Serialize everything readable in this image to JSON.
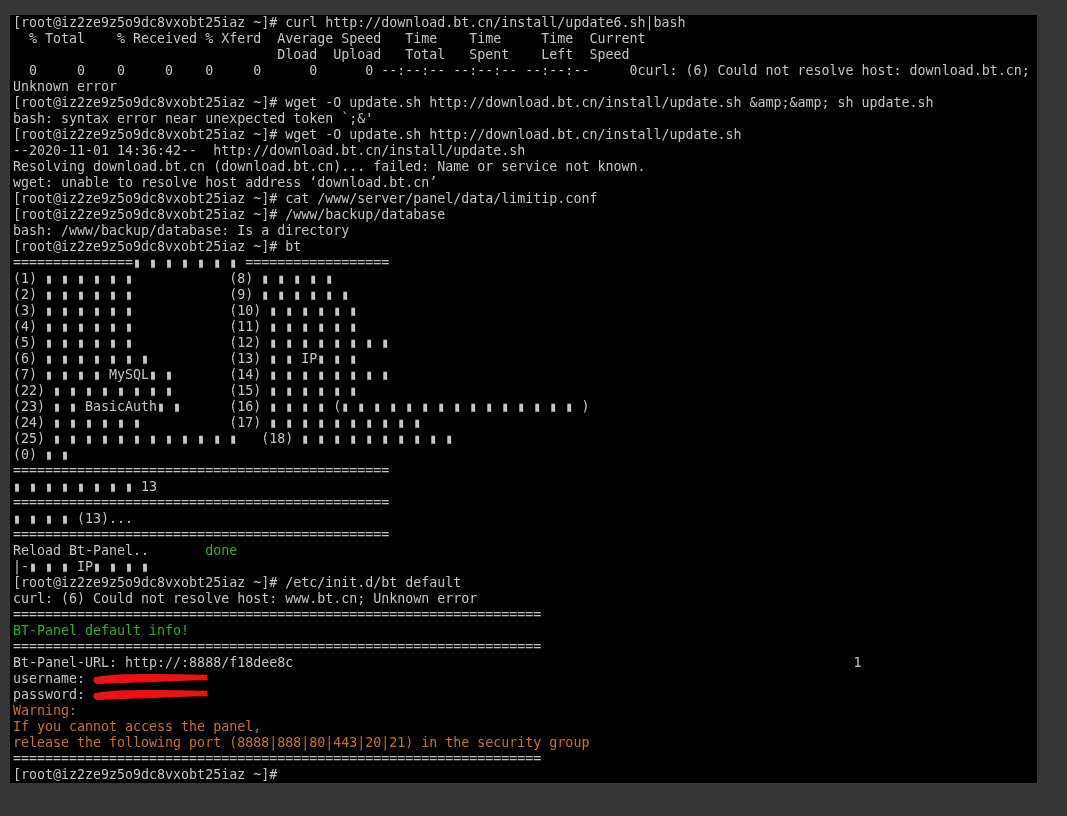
{
  "terminal": {
    "lines": [
      {
        "segments": [
          {
            "text": "[root@iz2ze9z5o9dc8vxobt25iaz ~]# curl http://download.bt.cn/install/update6.sh|bash",
            "color": "#c4c4c4"
          }
        ]
      },
      {
        "segments": [
          {
            "text": "  % Total    % Received % Xferd  Average Speed   Time    Time     Time  Current",
            "color": "#c4c4c4"
          }
        ]
      },
      {
        "segments": [
          {
            "text": "                                 Dload  Upload   Total   Spent    Left  Speed",
            "color": "#c4c4c4"
          }
        ]
      },
      {
        "segments": [
          {
            "text": "  0     0    0     0    0     0      0      0 --:--:-- --:--:-- --:--:--     0curl: (6) Could not resolve host: download.bt.cn;",
            "color": "#c4c4c4"
          }
        ]
      },
      {
        "segments": [
          {
            "text": "Unknown error",
            "color": "#c4c4c4"
          }
        ]
      },
      {
        "segments": [
          {
            "text": "[root@iz2ze9z5o9dc8vxobt25iaz ~]# wget -O update.sh http://download.bt.cn/install/update.sh &amp;&amp; sh update.sh",
            "color": "#c4c4c4"
          }
        ]
      },
      {
        "segments": [
          {
            "text": "bash: syntax error near unexpected token `;&'",
            "color": "#c4c4c4"
          }
        ]
      },
      {
        "segments": [
          {
            "text": "[root@iz2ze9z5o9dc8vxobt25iaz ~]# wget -O update.sh http://download.bt.cn/install/update.sh",
            "color": "#c4c4c4"
          }
        ]
      },
      {
        "segments": [
          {
            "text": "--2020-11-01 14:36:42--  http://download.bt.cn/install/update.sh",
            "color": "#c4c4c4"
          }
        ]
      },
      {
        "segments": [
          {
            "text": "Resolving download.bt.cn (download.bt.cn)... failed: Name or service not known.",
            "color": "#c4c4c4"
          }
        ]
      },
      {
        "segments": [
          {
            "text": "wget: unable to resolve host address ‘download.bt.cn’",
            "color": "#c4c4c4"
          }
        ]
      },
      {
        "segments": [
          {
            "text": "[root@iz2ze9z5o9dc8vxobt25iaz ~]# cat /www/server/panel/data/limitip.conf",
            "color": "#c4c4c4"
          }
        ]
      },
      {
        "segments": [
          {
            "text": "[root@iz2ze9z5o9dc8vxobt25iaz ~]# /www/backup/database",
            "color": "#c4c4c4"
          }
        ]
      },
      {
        "segments": [
          {
            "text": "bash: /www/backup/database: Is a directory",
            "color": "#c4c4c4"
          }
        ]
      },
      {
        "segments": [
          {
            "text": "[root@iz2ze9z5o9dc8vxobt25iaz ~]# bt",
            "color": "#c4c4c4"
          }
        ]
      },
      {
        "segments": [
          {
            "text": "===============▮ ▮ ▮ ▮ ▮ ▮ ▮ ==================",
            "color": "#c4c4c4"
          }
        ]
      },
      {
        "segments": [
          {
            "text": "(1) ▮ ▮ ▮ ▮ ▮ ▮            (8) ▮ ▮ ▮ ▮ ▮",
            "color": "#c4c4c4"
          }
        ]
      },
      {
        "segments": [
          {
            "text": "(2) ▮ ▮ ▮ ▮ ▮ ▮            (9) ▮ ▮ ▮ ▮ ▮ ▮",
            "color": "#c4c4c4"
          }
        ]
      },
      {
        "segments": [
          {
            "text": "(3) ▮ ▮ ▮ ▮ ▮ ▮            (10) ▮ ▮ ▮ ▮ ▮ ▮",
            "color": "#c4c4c4"
          }
        ]
      },
      {
        "segments": [
          {
            "text": "(4) ▮ ▮ ▮ ▮ ▮ ▮            (11) ▮ ▮ ▮ ▮ ▮ ▮",
            "color": "#c4c4c4"
          }
        ]
      },
      {
        "segments": [
          {
            "text": "(5) ▮ ▮ ▮ ▮ ▮ ▮            (12) ▮ ▮ ▮ ▮ ▮ ▮ ▮ ▮",
            "color": "#c4c4c4"
          }
        ]
      },
      {
        "segments": [
          {
            "text": "(6) ▮ ▮ ▮ ▮ ▮ ▮ ▮          (13) ▮ ▮ IP▮ ▮ ▮",
            "color": "#c4c4c4"
          }
        ]
      },
      {
        "segments": [
          {
            "text": "(7) ▮ ▮ ▮ ▮ MySQL▮ ▮       (14) ▮ ▮ ▮ ▮ ▮ ▮ ▮ ▮",
            "color": "#c4c4c4"
          }
        ]
      },
      {
        "segments": [
          {
            "text": "(22) ▮ ▮ ▮ ▮ ▮ ▮ ▮ ▮       (15) ▮ ▮ ▮ ▮ ▮ ▮",
            "color": "#c4c4c4"
          }
        ]
      },
      {
        "segments": [
          {
            "text": "(23) ▮ ▮ BasicAuth▮ ▮      (16) ▮ ▮ ▮ ▮ (▮ ▮ ▮ ▮ ▮ ▮ ▮ ▮ ▮ ▮ ▮ ▮ ▮ ▮ ▮ )",
            "color": "#c4c4c4"
          }
        ]
      },
      {
        "segments": [
          {
            "text": "(24) ▮ ▮ ▮ ▮ ▮ ▮           (17) ▮ ▮ ▮ ▮ ▮ ▮ ▮ ▮ ▮ ▮",
            "color": "#c4c4c4"
          }
        ]
      },
      {
        "segments": [
          {
            "text": "(25) ▮ ▮ ▮ ▮ ▮ ▮ ▮ ▮ ▮ ▮ ▮ ▮   (18) ▮ ▮ ▮ ▮ ▮ ▮ ▮ ▮ ▮ ▮",
            "color": "#c4c4c4"
          }
        ]
      },
      {
        "segments": [
          {
            "text": "(0) ▮ ▮",
            "color": "#c4c4c4"
          }
        ]
      },
      {
        "segments": [
          {
            "text": "===============================================",
            "color": "#c4c4c4"
          }
        ]
      },
      {
        "segments": [
          {
            "text": "▮ ▮ ▮ ▮ ▮ ▮ ▮ ▮ 13",
            "color": "#c4c4c4"
          }
        ]
      },
      {
        "segments": [
          {
            "text": "===============================================",
            "color": "#c4c4c4"
          }
        ]
      },
      {
        "segments": [
          {
            "text": "▮ ▮ ▮ ▮ (13)...",
            "color": "#c4c4c4"
          }
        ]
      },
      {
        "segments": [
          {
            "text": "===============================================",
            "color": "#c4c4c4"
          }
        ]
      },
      {
        "segments": [
          {
            "text": "Reload Bt-Panel..",
            "color": "#c4c4c4"
          },
          {
            "text": "       done",
            "color": "#22b422"
          }
        ]
      },
      {
        "segments": [
          {
            "text": "|-▮ ▮ ▮ IP▮ ▮ ▮ ▮",
            "color": "#c4c4c4"
          }
        ]
      },
      {
        "segments": [
          {
            "text": "[root@iz2ze9z5o9dc8vxobt25iaz ~]# /etc/init.d/bt default",
            "color": "#c4c4c4"
          }
        ]
      },
      {
        "segments": [
          {
            "text": "curl: (6) Could not resolve host: www.bt.cn; Unknown error",
            "color": "#c4c4c4"
          }
        ]
      },
      {
        "segments": [
          {
            "text": "==================================================================",
            "color": "#c4c4c4"
          }
        ]
      },
      {
        "segments": [
          {
            "text": "BT-Panel default info!",
            "color": "#22b422"
          }
        ]
      },
      {
        "segments": [
          {
            "text": "==================================================================",
            "color": "#c4c4c4"
          }
        ]
      },
      {
        "segments": [
          {
            "text": "Bt-Panel-URL: http://:8888/f18dee8c",
            "color": "#c4c4c4"
          },
          {
            "text": "                                                                      1",
            "color": "#c4c4c4"
          }
        ]
      },
      {
        "segments": [
          {
            "text": "username:",
            "color": "#c4c4c4",
            "redacted": true
          }
        ]
      },
      {
        "segments": [
          {
            "text": "password:",
            "color": "#c4c4c4",
            "redacted": true
          }
        ]
      },
      {
        "segments": [
          {
            "text": "Warning:",
            "color": "#c8741c"
          }
        ]
      },
      {
        "segments": [
          {
            "text": "If you cannot access the panel,",
            "color": "#c8741c"
          }
        ]
      },
      {
        "segments": [
          {
            "text": "release the following port (8888|888|80|443|20|21) in the security group",
            "color": "#c8741c"
          }
        ]
      },
      {
        "segments": [
          {
            "text": "==================================================================",
            "color": "#c4c4c4"
          }
        ]
      },
      {
        "segments": [
          {
            "text": "[root@iz2ze9z5o9dc8vxobt25iaz ~]#",
            "color": "#c4c4c4"
          }
        ]
      }
    ]
  }
}
